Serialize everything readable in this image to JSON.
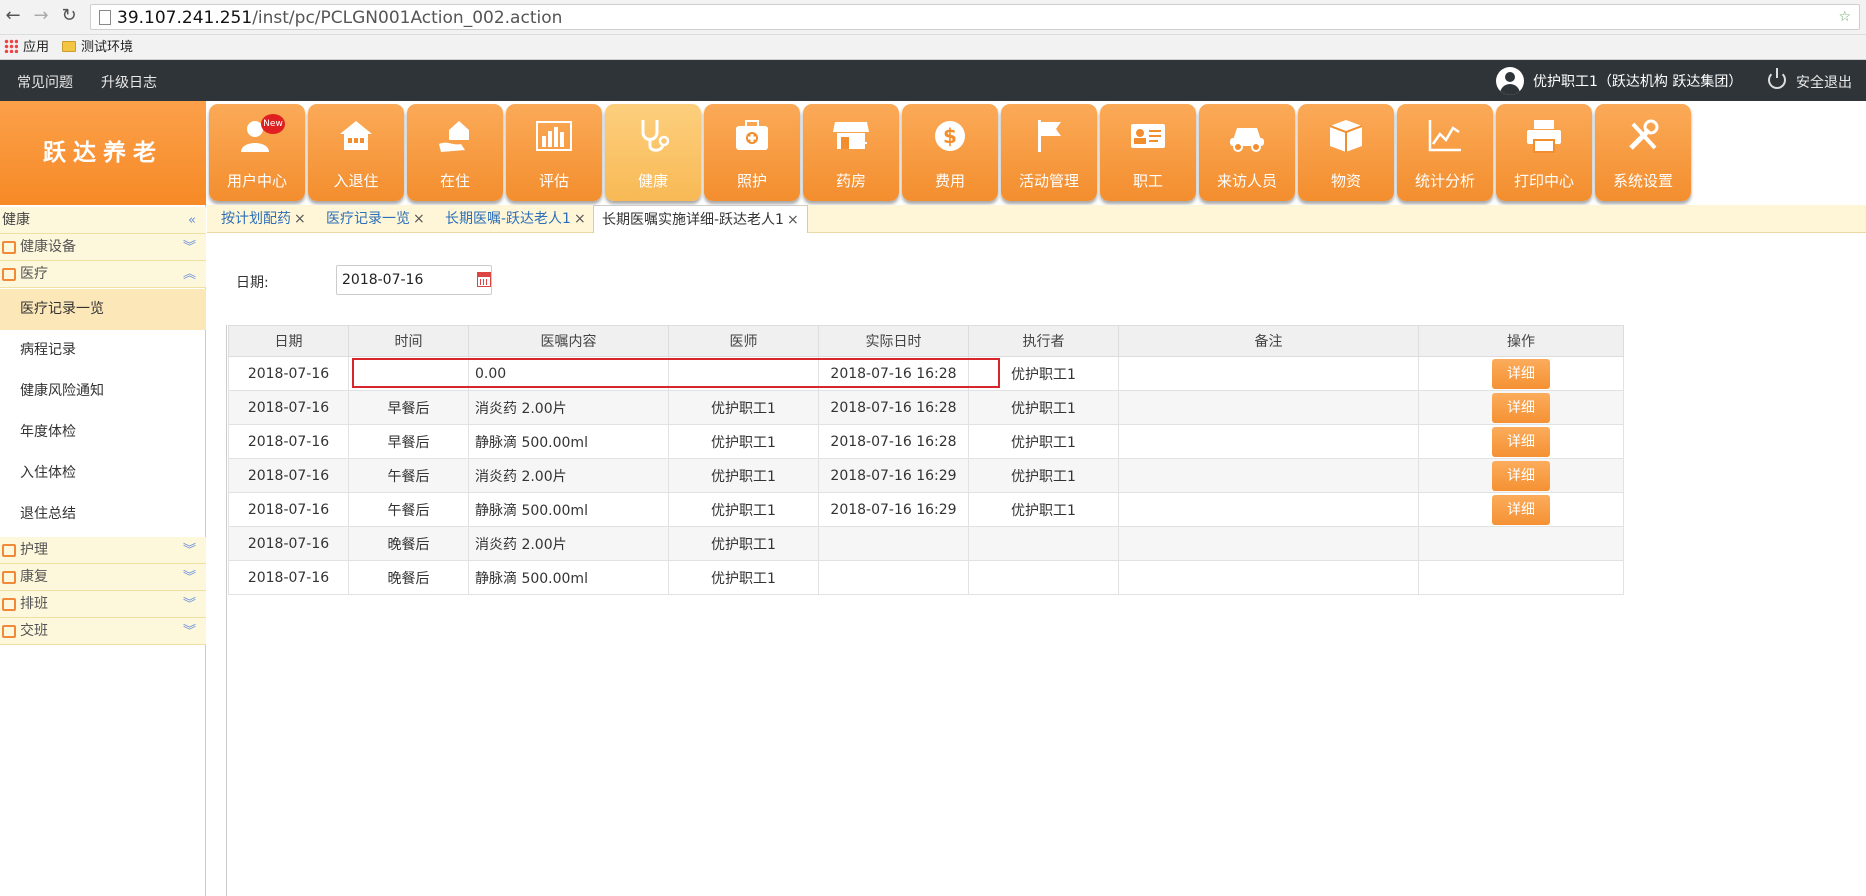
{
  "browser": {
    "url_host": "39.107.241.251",
    "url_path": "/inst/pc/PCLGN001Action_002.action",
    "bookmarks": [
      "应用",
      "测试环境"
    ]
  },
  "topbar": {
    "faq": "常见问题",
    "changelog": "升级日志",
    "user": "优护职工1（跃达机构 跃达集团）",
    "logout": "安全退出"
  },
  "logo": "跃达养老",
  "modules": [
    {
      "label": "用户中心",
      "icon": "user-icon",
      "badge": "New"
    },
    {
      "label": "入退住",
      "icon": "house-icon"
    },
    {
      "label": "在住",
      "icon": "hand-house-icon"
    },
    {
      "label": "评估",
      "icon": "bar-chart-icon"
    },
    {
      "label": "健康",
      "icon": "stethoscope-icon",
      "active": true
    },
    {
      "label": "照护",
      "icon": "medical-kit-icon"
    },
    {
      "label": "药房",
      "icon": "store-icon"
    },
    {
      "label": "费用",
      "icon": "dollar-icon"
    },
    {
      "label": "活动管理",
      "icon": "flag-icon"
    },
    {
      "label": "职工",
      "icon": "id-card-icon"
    },
    {
      "label": "来访人员",
      "icon": "car-icon"
    },
    {
      "label": "物资",
      "icon": "box-icon"
    },
    {
      "label": "统计分析",
      "icon": "line-chart-icon"
    },
    {
      "label": "打印中心",
      "icon": "printer-icon"
    },
    {
      "label": "系统设置",
      "icon": "tools-icon"
    }
  ],
  "sidebar": {
    "header": "健康",
    "categories": {
      "devices": "健康设备",
      "medical": "医疗",
      "nursing": "护理",
      "rehab": "康复",
      "schedule": "排班",
      "handover": "交班"
    },
    "items": [
      "医疗记录一览",
      "病程记录",
      "健康风险通知",
      "年度体检",
      "入住体检",
      "退住总结"
    ]
  },
  "tabs": [
    {
      "label": "按计划配药"
    },
    {
      "label": "医疗记录一览"
    },
    {
      "label": "长期医嘱-跃达老人1"
    },
    {
      "label": "长期医嘱实施详细-跃达老人1",
      "active": true
    }
  ],
  "filter": {
    "date_label": "日期:",
    "date_value": "2018-07-16"
  },
  "table": {
    "columns": [
      "日期",
      "时间",
      "医嘱内容",
      "医师",
      "实际日时",
      "执行者",
      "备注",
      "操作"
    ],
    "detail_label": "详细",
    "rows": [
      {
        "date": "2018-07-16",
        "time": "",
        "content": "0.00",
        "doctor": "",
        "actual": "2018-07-16 16:28",
        "executor": "优护职工1",
        "note": "",
        "has_detail": true
      },
      {
        "date": "2018-07-16",
        "time": "早餐后",
        "content": "消炎药 2.00片",
        "doctor": "优护职工1",
        "actual": "2018-07-16 16:28",
        "executor": "优护职工1",
        "note": "",
        "has_detail": true
      },
      {
        "date": "2018-07-16",
        "time": "早餐后",
        "content": "静脉滴 500.00ml",
        "doctor": "优护职工1",
        "actual": "2018-07-16 16:28",
        "executor": "优护职工1",
        "note": "",
        "has_detail": true
      },
      {
        "date": "2018-07-16",
        "time": "午餐后",
        "content": "消炎药 2.00片",
        "doctor": "优护职工1",
        "actual": "2018-07-16 16:29",
        "executor": "优护职工1",
        "note": "",
        "has_detail": true
      },
      {
        "date": "2018-07-16",
        "time": "午餐后",
        "content": "静脉滴 500.00ml",
        "doctor": "优护职工1",
        "actual": "2018-07-16 16:29",
        "executor": "优护职工1",
        "note": "",
        "has_detail": true
      },
      {
        "date": "2018-07-16",
        "time": "晚餐后",
        "content": "消炎药 2.00片",
        "doctor": "优护职工1",
        "actual": "",
        "executor": "",
        "note": "",
        "has_detail": false
      },
      {
        "date": "2018-07-16",
        "time": "晚餐后",
        "content": "静脉滴 500.00ml",
        "doctor": "优护职工1",
        "actual": "",
        "executor": "",
        "note": "",
        "has_detail": false
      }
    ]
  },
  "colors": {
    "accent_orange": "#f68a26",
    "topbar_dark": "#2e3438",
    "highlight_red": "#d6252b"
  }
}
